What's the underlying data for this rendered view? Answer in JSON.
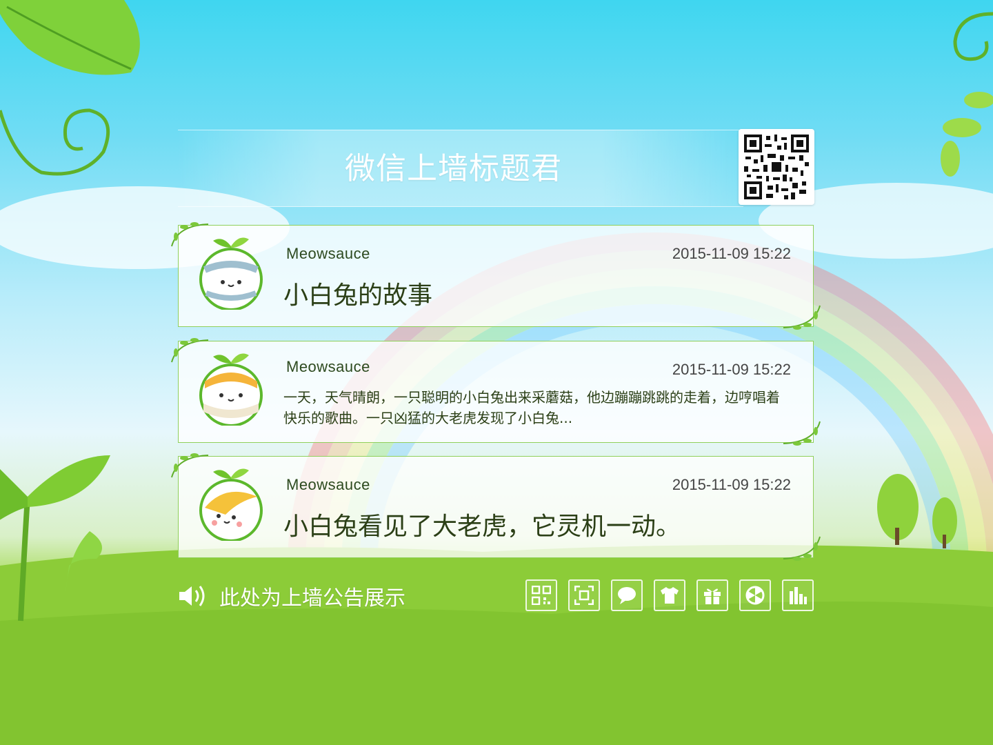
{
  "header": {
    "title": "微信上墙标题君",
    "qr_icon": "qr-code"
  },
  "messages": [
    {
      "name": "Meowsauce",
      "time": "2015-11-09 15:22",
      "text": "小白兔的故事",
      "size": "large",
      "avatar_icon": "cat-avatar-striped"
    },
    {
      "name": "Meowsauce",
      "time": "2015-11-09 15:22",
      "text": "一天，天气晴朗，一只聪明的小白兔出来采蘑菇，他边蹦蹦跳跳的走着，边哼唱着快乐的歌曲。一只凶猛的大老虎发现了小白兔...",
      "size": "small",
      "avatar_icon": "cat-avatar-scarf"
    },
    {
      "name": "Meowsauce",
      "time": "2015-11-09 15:22",
      "text": "小白兔看见了大老虎，它灵机一动。",
      "size": "large",
      "avatar_icon": "cat-avatar-hat"
    }
  ],
  "notice": {
    "text": "此处为上墙公告展示",
    "icon": "speaker-icon"
  },
  "toolbar": [
    {
      "icon": "qr-code-icon"
    },
    {
      "icon": "fullscreen-icon"
    },
    {
      "icon": "chat-icon"
    },
    {
      "icon": "shirt-icon"
    },
    {
      "icon": "gift-icon"
    },
    {
      "icon": "lottery-wheel-icon"
    },
    {
      "icon": "bar-chart-icon"
    }
  ],
  "colors": {
    "card_border": "#8fcf5a",
    "text_dark": "#2b3f16",
    "sky_top": "#3fd6f0",
    "grass": "#7cc22c"
  }
}
